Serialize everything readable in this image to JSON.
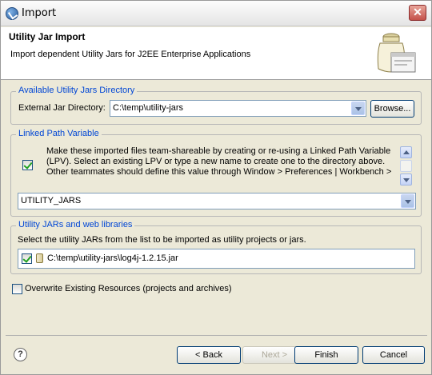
{
  "window": {
    "title": "Import",
    "close_label": "✕"
  },
  "header": {
    "title": "Utility Jar Import",
    "description": "Import dependent Utility Jars for J2EE Enterprise Applications"
  },
  "available_dir": {
    "group_label": "Available Utility Jars Directory",
    "field_label": "External Jar Directory:",
    "field_value": "C:\\temp\\utility-jars",
    "browse_label": "Browse..."
  },
  "linked_path": {
    "group_label": "Linked Path Variable",
    "checkbox_checked": true,
    "text_lines": [
      "Make these imported files team-shareable by creating or re-using a Linked Path Variable",
      "(LPV). Select an existing LPV or type a new name to create one to the directory above.",
      "Other teammates should define this value through Window > Preferences | Workbench >"
    ],
    "variable_value": "UTILITY_JARS"
  },
  "libraries": {
    "group_label": "Utility JARs and web libraries",
    "instruction": "Select the utility JARs from the list to be imported as utility projects or jars.",
    "items": [
      {
        "checked": true,
        "label": "C:\\temp\\utility-jars\\log4j-1.2.15.jar"
      }
    ]
  },
  "overwrite": {
    "checked": false,
    "label": "Overwrite Existing Resources (projects and archives)"
  },
  "footer": {
    "help_label": "?",
    "back_label": "< Back",
    "next_label": "Next >",
    "finish_label": "Finish",
    "cancel_label": "Cancel"
  },
  "colors": {
    "group_label": "#0046d5",
    "dialog_bg": "#ece9d8",
    "header_bg": "#ffffff"
  }
}
